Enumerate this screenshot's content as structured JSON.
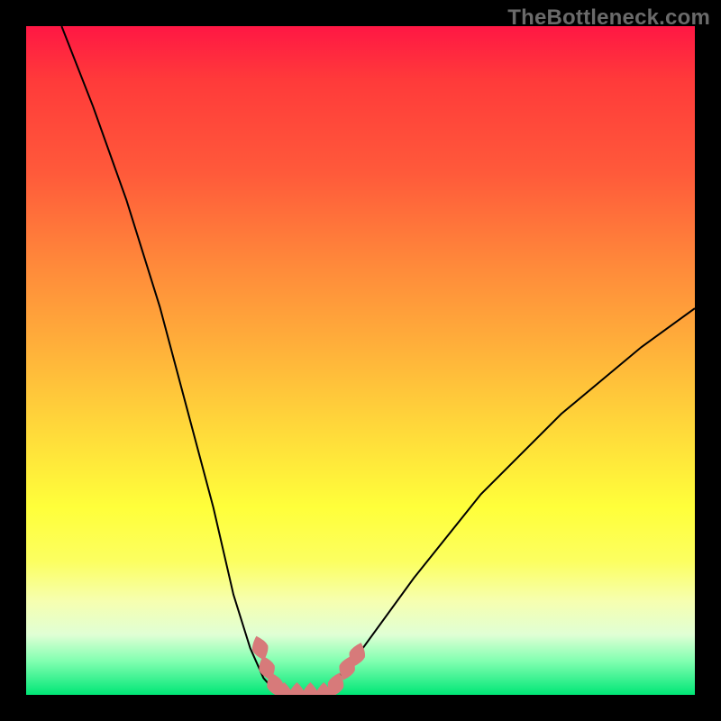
{
  "watermark": "TheBottleneck.com",
  "chart_data": {
    "type": "line",
    "title": "",
    "xlabel": "",
    "ylabel": "",
    "xlim": [
      0,
      1
    ],
    "ylim": [
      0,
      1
    ],
    "series": [
      {
        "name": "left-branch",
        "x": [
          0.053,
          0.1,
          0.15,
          0.2,
          0.24,
          0.28,
          0.31,
          0.335,
          0.355,
          0.37,
          0.386
        ],
        "y": [
          1.0,
          0.88,
          0.74,
          0.58,
          0.43,
          0.28,
          0.15,
          0.07,
          0.025,
          0.008,
          0.0
        ]
      },
      {
        "name": "valley-floor",
        "x": [
          0.386,
          0.445
        ],
        "y": [
          0.0,
          0.0
        ]
      },
      {
        "name": "right-branch",
        "x": [
          0.445,
          0.5,
          0.58,
          0.68,
          0.8,
          0.92,
          1.0
        ],
        "y": [
          0.0,
          0.065,
          0.175,
          0.3,
          0.42,
          0.52,
          0.578
        ]
      }
    ],
    "markers": {
      "name": "highlight-lozenges",
      "points": [
        {
          "x": 0.35,
          "y": 0.07
        },
        {
          "x": 0.36,
          "y": 0.04
        },
        {
          "x": 0.372,
          "y": 0.015
        },
        {
          "x": 0.386,
          "y": 0.0
        },
        {
          "x": 0.405,
          "y": 0.0
        },
        {
          "x": 0.425,
          "y": 0.0
        },
        {
          "x": 0.445,
          "y": 0.0
        },
        {
          "x": 0.463,
          "y": 0.015
        },
        {
          "x": 0.48,
          "y": 0.04
        },
        {
          "x": 0.495,
          "y": 0.06
        }
      ]
    }
  }
}
